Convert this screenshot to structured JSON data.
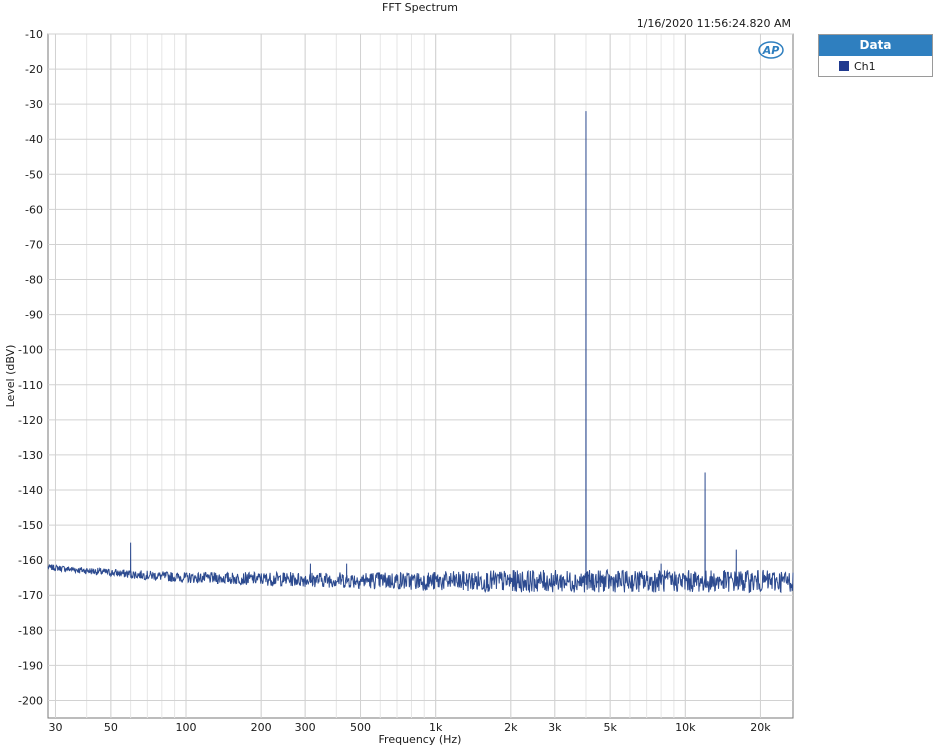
{
  "chart_data": {
    "type": "line",
    "title": "FFT Spectrum",
    "timestamp": "1/16/2020 11:56:24.820 AM",
    "xlabel": "Frequency (Hz)",
    "ylabel": "Level (dBV)",
    "x_scale": "log",
    "xlim": [
      28,
      27000
    ],
    "ylim": [
      -205,
      -10
    ],
    "x_ticks": [
      {
        "value": 30,
        "label": "30"
      },
      {
        "value": 50,
        "label": "50"
      },
      {
        "value": 100,
        "label": "100"
      },
      {
        "value": 200,
        "label": "200"
      },
      {
        "value": 300,
        "label": "300"
      },
      {
        "value": 500,
        "label": "500"
      },
      {
        "value": 1000,
        "label": "1k"
      },
      {
        "value": 2000,
        "label": "2k"
      },
      {
        "value": 3000,
        "label": "3k"
      },
      {
        "value": 5000,
        "label": "5k"
      },
      {
        "value": 10000,
        "label": "10k"
      },
      {
        "value": 20000,
        "label": "20k"
      }
    ],
    "y_ticks": [
      -10,
      -20,
      -30,
      -40,
      -50,
      -60,
      -70,
      -80,
      -90,
      -100,
      -110,
      -120,
      -130,
      -140,
      -150,
      -160,
      -170,
      -180,
      -190,
      -200
    ],
    "grid": true,
    "legend_position": "top-right, outside plot",
    "series": [
      {
        "name": "Ch1",
        "color": "#2c4a8f",
        "noise_floor": [
          {
            "freq": 28,
            "level": -162
          },
          {
            "freq": 40,
            "level": -163
          },
          {
            "freq": 60,
            "level": -164
          },
          {
            "freq": 100,
            "level": -165
          },
          {
            "freq": 300,
            "level": -165.5
          },
          {
            "freq": 1000,
            "level": -166
          },
          {
            "freq": 4000,
            "level": -166
          },
          {
            "freq": 10000,
            "level": -166
          },
          {
            "freq": 27000,
            "level": -166
          }
        ],
        "peaks": [
          {
            "freq": 60,
            "level": -155
          },
          {
            "freq": 315,
            "level": -161
          },
          {
            "freq": 440,
            "level": -161
          },
          {
            "freq": 4000,
            "level": -32
          },
          {
            "freq": 8000,
            "level": -161
          },
          {
            "freq": 12000,
            "level": -135
          },
          {
            "freq": 16000,
            "level": -157
          }
        ]
      }
    ]
  },
  "legend": {
    "header": "Data",
    "items": [
      {
        "label": "Ch1",
        "color": "#203a8f"
      }
    ]
  },
  "logo_text": "AP"
}
